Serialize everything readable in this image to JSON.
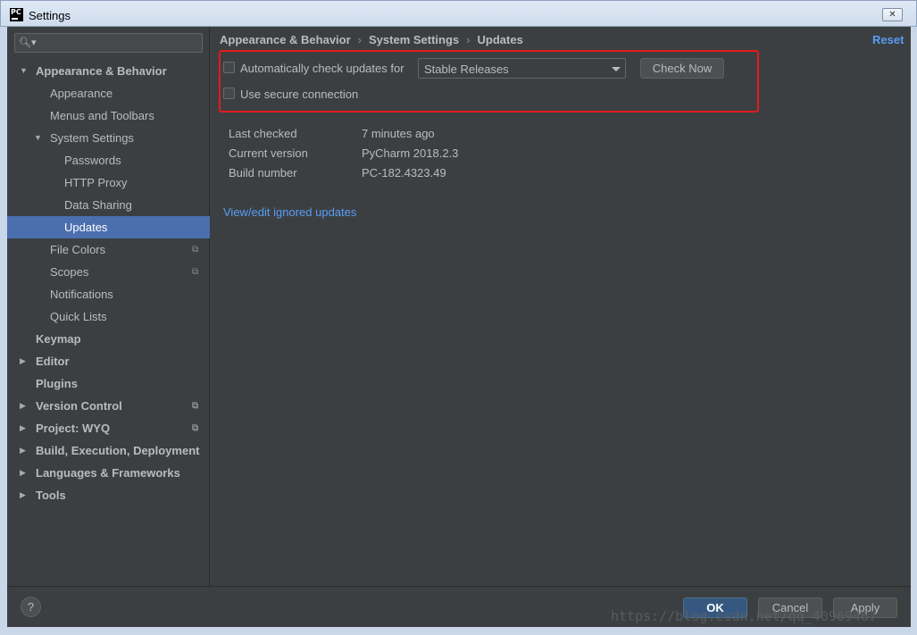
{
  "window": {
    "title": "Settings",
    "app_icon_text": "PC",
    "close_label": "✕"
  },
  "search": {
    "placeholder": "",
    "value": ""
  },
  "sidebar": {
    "items": [
      {
        "label": "Appearance & Behavior",
        "expanded": true
      },
      {
        "label": "Appearance"
      },
      {
        "label": "Menus and Toolbars"
      },
      {
        "label": "System Settings",
        "expanded": true
      },
      {
        "label": "Passwords"
      },
      {
        "label": "HTTP Proxy"
      },
      {
        "label": "Data Sharing"
      },
      {
        "label": "Updates",
        "selected": true
      },
      {
        "label": "File Colors"
      },
      {
        "label": "Scopes"
      },
      {
        "label": "Notifications"
      },
      {
        "label": "Quick Lists"
      },
      {
        "label": "Keymap"
      },
      {
        "label": "Editor"
      },
      {
        "label": "Plugins"
      },
      {
        "label": "Version Control"
      },
      {
        "label": "Project: WYQ"
      },
      {
        "label": "Build, Execution, Deployment"
      },
      {
        "label": "Languages & Frameworks"
      },
      {
        "label": "Tools"
      }
    ]
  },
  "breadcrumb": {
    "items": [
      "Appearance & Behavior",
      "System Settings",
      "Updates"
    ],
    "separator": "›"
  },
  "reset_label": "Reset",
  "updates": {
    "auto_check_label": "Automatically check updates for",
    "auto_check_checked": false,
    "channel_value": "Stable Releases",
    "check_now_label": "Check Now",
    "secure_label": "Use secure connection",
    "secure_checked": false
  },
  "info": {
    "last_checked_label": "Last checked",
    "last_checked_value": "7 minutes ago",
    "current_version_label": "Current version",
    "current_version_value": "PyCharm 2018.2.3",
    "build_number_label": "Build number",
    "build_number_value": "PC-182.4323.49"
  },
  "ignored_link": "View/edit ignored updates",
  "footer": {
    "help_label": "?",
    "ok_label": "OK",
    "cancel_label": "Cancel",
    "apply_label": "Apply"
  },
  "watermark": "https://blog.csdn.net/qq_40969467",
  "colors": {
    "background": "#3c3f41",
    "selection": "#4b6eaf",
    "link": "#589df6",
    "highlight_border": "#e11b1b"
  }
}
